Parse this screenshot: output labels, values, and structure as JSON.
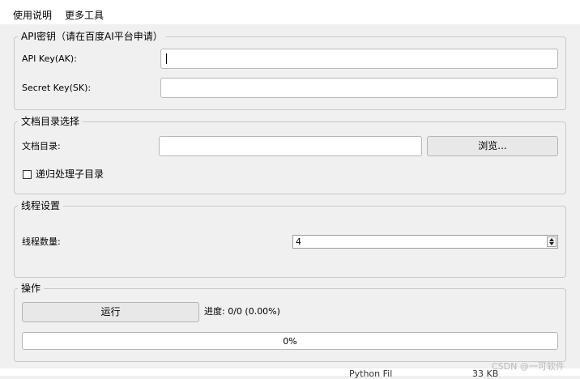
{
  "menu": {
    "items": [
      "使用说明",
      "更多工具"
    ]
  },
  "api_group": {
    "title": "API密钥（请在百度AI平台申请）",
    "api_key_label": "API Key(AK):",
    "api_key_value": "",
    "secret_key_label": "Secret Key(SK):",
    "secret_key_value": ""
  },
  "doc_group": {
    "title": "文档目录选择",
    "dir_label": "文档目录:",
    "dir_value": "",
    "browse_label": "浏览...",
    "recursive_label": "递归处理子目录",
    "recursive_checked": false
  },
  "thread_group": {
    "title": "线程设置",
    "count_label": "线程数量:",
    "count_value": "4"
  },
  "op_group": {
    "title": "操作",
    "run_label": "运行",
    "progress_text": "进度: 0/0 (0.00%)",
    "progress_percent": 0,
    "progress_bar_text": "0%"
  },
  "watermark": "CSDN @一可软件",
  "background_window": {
    "left_text": "Python Fil",
    "right_text": "33 KB"
  }
}
